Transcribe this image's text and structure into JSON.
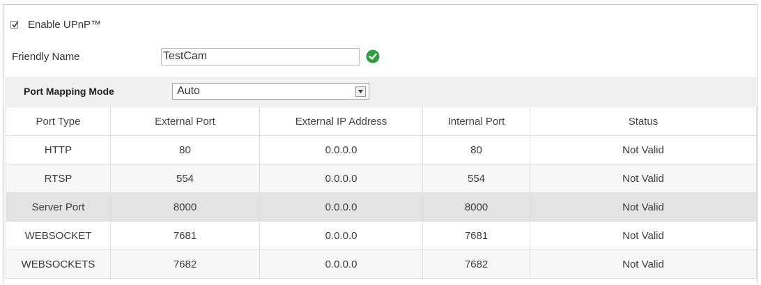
{
  "upnp": {
    "label": "Enable UPnP™",
    "checked": true
  },
  "friendly_name": {
    "label": "Friendly Name",
    "value": "TestCam",
    "status_icon": "check-circle-icon",
    "status_color": "#2e9e3f"
  },
  "port_mapping": {
    "label": "Port Mapping Mode",
    "selected": "Auto"
  },
  "table": {
    "headers": [
      "Port Type",
      "External Port",
      "External IP Address",
      "Internal Port",
      "Status"
    ],
    "rows": [
      [
        "HTTP",
        "80",
        "0.0.0.0",
        "80",
        "Not Valid"
      ],
      [
        "RTSP",
        "554",
        "0.0.0.0",
        "554",
        "Not Valid"
      ],
      [
        "Server Port",
        "8000",
        "0.0.0.0",
        "8000",
        "Not Valid"
      ],
      [
        "WEBSOCKET",
        "7681",
        "0.0.0.0",
        "7681",
        "Not Valid"
      ],
      [
        "WEBSOCKETS",
        "7682",
        "0.0.0.0",
        "7682",
        "Not Valid"
      ]
    ]
  }
}
